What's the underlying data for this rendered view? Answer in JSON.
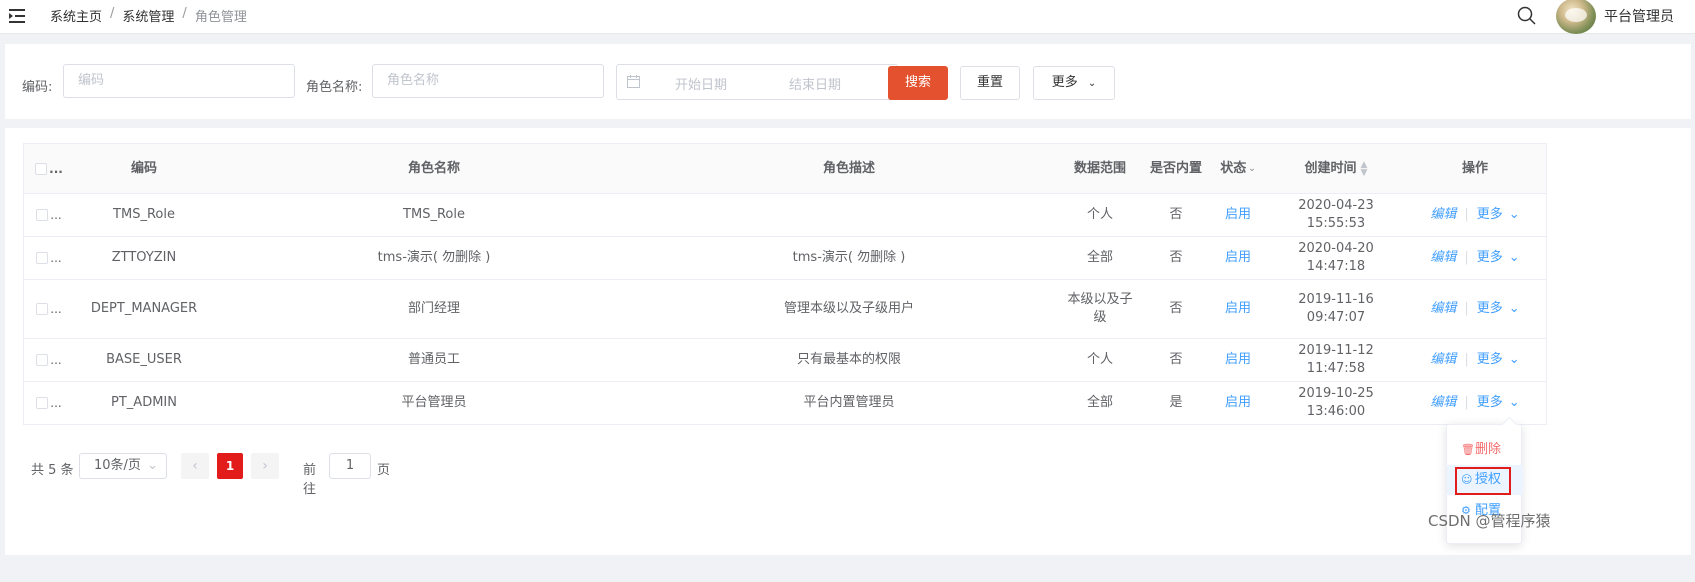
{
  "header": {
    "breadcrumb": [
      "系统主页",
      "系统管理",
      "角色管理"
    ],
    "separator": "/",
    "username": "平台管理员",
    "icons": {
      "menu": "menu-fold-icon",
      "search": "search-icon",
      "avatar": "user-avatar"
    }
  },
  "filters": {
    "code_label": "编码:",
    "code_placeholder": "编码",
    "name_label": "角色名称:",
    "name_placeholder": "角色名称",
    "start_date_placeholder": "开始日期",
    "end_date_placeholder": "结束日期",
    "search_button": "搜索",
    "reset_button": "重置",
    "more_button": "更多",
    "accent_color": "#e4512f"
  },
  "table": {
    "columns": [
      "编码",
      "角色名称",
      "角色描述",
      "数据范围",
      "是否内置",
      "状态",
      "创建时间",
      "操作"
    ],
    "rows": [
      {
        "code": "TMS_Role",
        "name": "TMS_Role",
        "desc": "",
        "scope": "个人",
        "builtin": "否",
        "status": "启用",
        "created": "2020-04-23 15:55:53"
      },
      {
        "code": "ZTTOYZIN",
        "name": "tms-演示( 勿删除 )",
        "desc": "tms-演示( 勿删除 )",
        "scope": "全部",
        "builtin": "否",
        "status": "启用",
        "created": "2020-04-20 14:47:18"
      },
      {
        "code": "DEPT_MANAGER",
        "name": "部门经理",
        "desc": "管理本级以及子级用户",
        "scope": "本级以及子级",
        "builtin": "否",
        "status": "启用",
        "created": "2019-11-16 09:47:07"
      },
      {
        "code": "BASE_USER",
        "name": "普通员工",
        "desc": "只有最基本的权限",
        "scope": "个人",
        "builtin": "否",
        "status": "启用",
        "created": "2019-11-12 11:47:58"
      },
      {
        "code": "PT_ADMIN",
        "name": "平台管理员",
        "desc": "平台内置管理员",
        "scope": "全部",
        "builtin": "是",
        "status": "启用",
        "created": "2019-10-25 13:46:00"
      }
    ],
    "edit_label": "编辑",
    "more_label": "更多",
    "link_color": "#409eff"
  },
  "pagination": {
    "total": "共 5 条",
    "page_size": "10条/页",
    "current_page": "1",
    "goto_label": "前往",
    "goto_value": "1",
    "page_suffix": "页",
    "current_color": "#e21b1b"
  },
  "dropdown": {
    "items": [
      "删除",
      "授权",
      "配置"
    ]
  },
  "watermark": "CSDN @管程序猿"
}
